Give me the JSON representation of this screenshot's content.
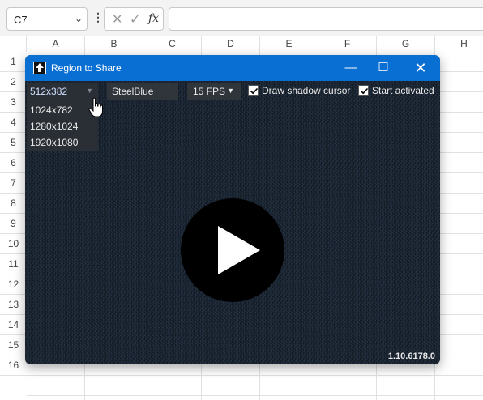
{
  "excel": {
    "namebox": {
      "value": "C7"
    },
    "formula_bar": {
      "dots": "⋮",
      "cancel_glyph": "✕",
      "enter_glyph": "✓",
      "fx_label": "fx",
      "value": ""
    },
    "columns": [
      "A",
      "B",
      "C",
      "D",
      "E",
      "F",
      "G",
      "H"
    ],
    "rows": [
      "1",
      "2",
      "3",
      "4",
      "5",
      "6",
      "7",
      "8",
      "9",
      "10",
      "11",
      "12",
      "13",
      "14",
      "15",
      "16"
    ]
  },
  "window": {
    "title": "Region to Share",
    "icon": "upload-arrow-icon",
    "title_bar_color": "#0a6fd2",
    "controls": {
      "minimize": "—",
      "maximize": "☐",
      "close": "✕"
    },
    "toolbar": {
      "resolution": {
        "selected": "512x382",
        "options": [
          "1024x782",
          "1280x1024",
          "1920x1080"
        ]
      },
      "color": {
        "selected": "SteelBlue"
      },
      "fps": {
        "selected": "15 FPS"
      },
      "draw_shadow_cursor": {
        "label": "Draw shadow cursor",
        "checked": true
      },
      "start_activated": {
        "label": "Start activated",
        "checked": true
      }
    },
    "play_icon": "play-icon",
    "version": "1.10.6178.0"
  }
}
